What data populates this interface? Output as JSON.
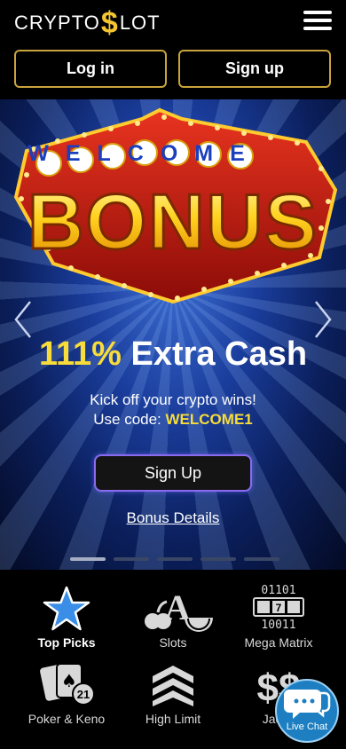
{
  "header": {
    "logo_left": "CRYPTO",
    "logo_symbol": "$",
    "logo_right": "LOT",
    "login_label": "Log in",
    "signup_label": "Sign up"
  },
  "banner": {
    "art_top": "WELCOME",
    "art_main": "BONUS",
    "headline_percent": "111%",
    "headline_text": "Extra Cash",
    "line1": "Kick off your crypto wins!",
    "line2_prefix": "Use code:",
    "code": "WELCOME1",
    "cta_label": "Sign Up",
    "details_label": "Bonus Details",
    "slide_count": 5,
    "active_slide": 1
  },
  "categories": [
    {
      "label": "Top Picks",
      "icon": "star-icon",
      "active": true
    },
    {
      "label": "Slots",
      "icon": "slots-icon",
      "active": false
    },
    {
      "label": "Mega Matrix",
      "icon": "matrix-icon",
      "active": false
    },
    {
      "label": "Poker & Keno",
      "icon": "cards-icon",
      "active": false
    },
    {
      "label": "High Limit",
      "icon": "chevrons-icon",
      "active": false
    },
    {
      "label": "Jackp",
      "icon": "dollar-icon",
      "active": false
    }
  ],
  "live_chat": {
    "label": "Live Chat"
  },
  "colors": {
    "accent_gold": "#f7dc3a",
    "button_border_gold": "#c9a33c",
    "cta_border": "#8a6bf0",
    "chat_blue": "#1d7fc1",
    "star_blue": "#3a8ee8"
  }
}
